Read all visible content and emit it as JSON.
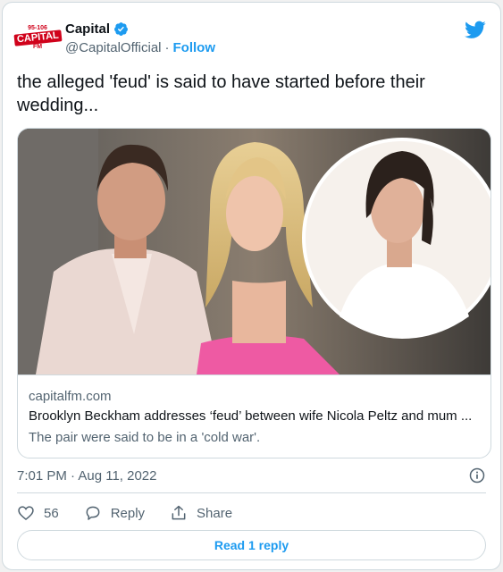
{
  "author": {
    "logo": {
      "line1": "95-106",
      "line2": "CAPITAL",
      "line3": "FM"
    },
    "display_name": "Capital",
    "handle": "@CapitalOfficial",
    "separator": "·",
    "follow_label": "Follow",
    "verified": true
  },
  "tweet": {
    "text": "the alleged 'feud' is said to have started before their wedding..."
  },
  "link_card": {
    "domain": "capitalfm.com",
    "title": "Brooklyn Beckham addresses ‘feud’ between wife Nicola Peltz and mum ...",
    "description": "The pair were said to be in a 'cold war'."
  },
  "meta": {
    "timestamp": "7:01 PM · Aug 11, 2022"
  },
  "actions": {
    "like_count": "56",
    "reply_label": "Reply",
    "share_label": "Share"
  },
  "read_replies_label": "Read 1 reply",
  "colors": {
    "accent": "#1d9bf0",
    "text": "#0f1419",
    "muted": "#536471",
    "border": "#cfd9de",
    "brand_red": "#d0021b"
  },
  "icons": [
    "verified-badge-icon",
    "twitter-bird-icon",
    "info-icon",
    "heart-icon",
    "reply-bubble-icon",
    "share-icon"
  ]
}
